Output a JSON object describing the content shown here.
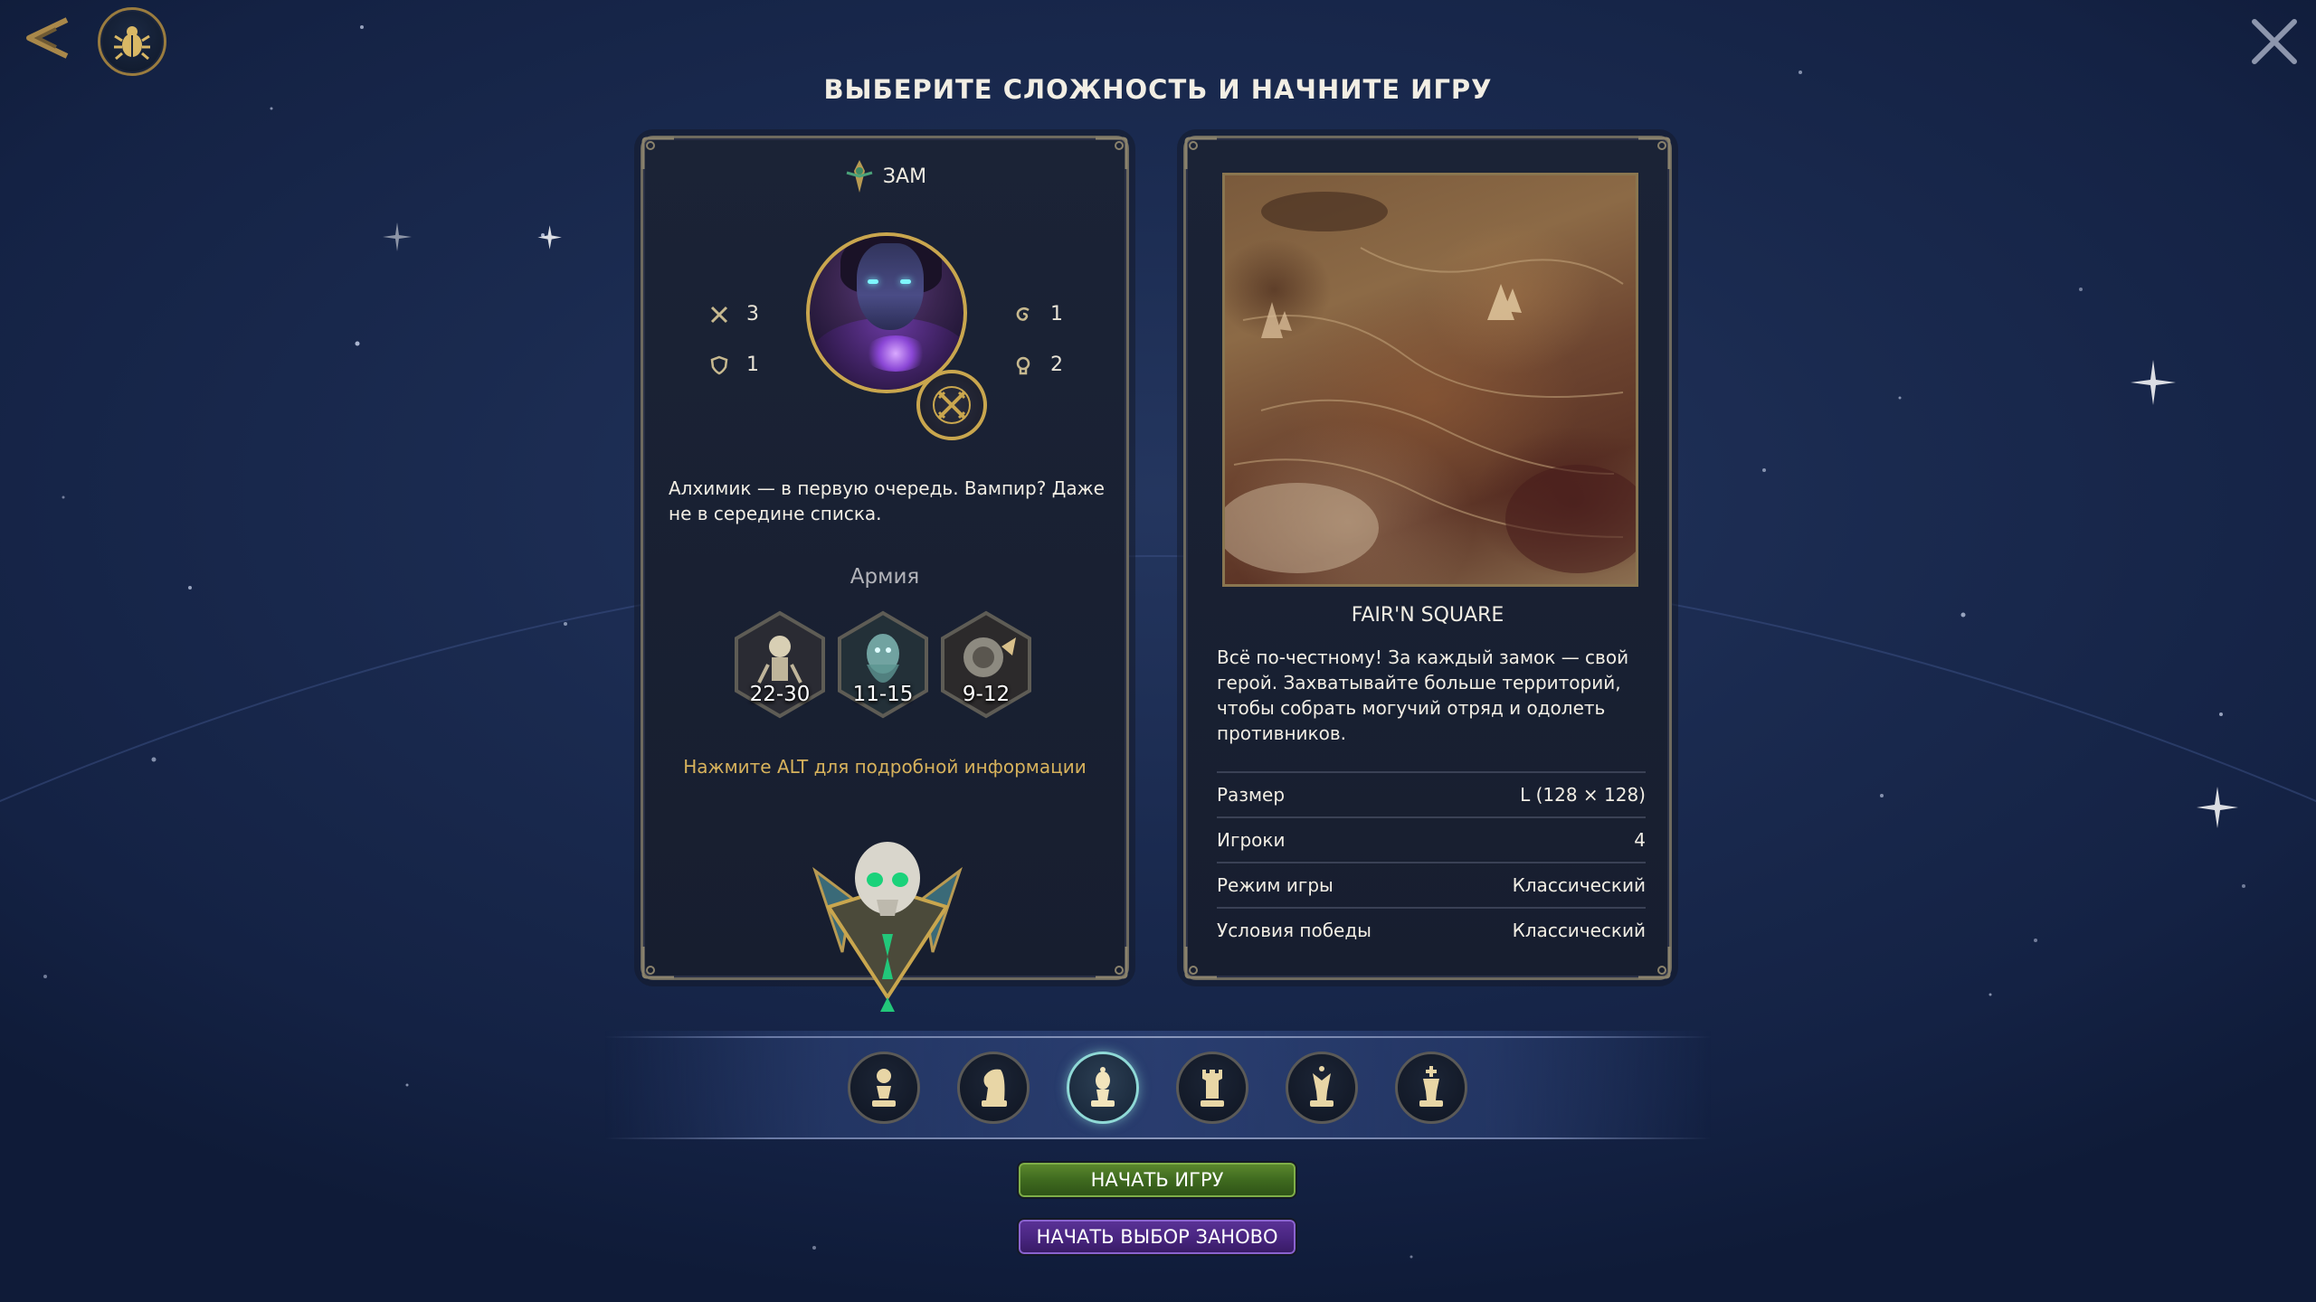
{
  "page": {
    "title": "ВЫБЕРИТЕ СЛОЖНОСТЬ И НАЧНИТЕ ИГРУ"
  },
  "toolbar": {
    "back_icon": "back-arrow-icon",
    "bug_icon": "bug-icon",
    "close_icon": "close-icon"
  },
  "hero": {
    "name": "ЗАМ",
    "stats": [
      {
        "icon": "crossed-swords-icon",
        "value": "3"
      },
      {
        "icon": "shield-icon",
        "value": "1"
      },
      {
        "icon": "spell-power-icon",
        "value": "1"
      },
      {
        "icon": "knowledge-icon",
        "value": "2"
      }
    ],
    "description": "Алхимик — в первую очередь. Вампир? Даже не в середине списка.",
    "army_title": "Армия",
    "army": [
      {
        "icon": "skeleton-unit-icon",
        "count": "22-30"
      },
      {
        "icon": "ghost-unit-icon",
        "count": "11-15"
      },
      {
        "icon": "beast-unit-icon",
        "count": "9-12"
      }
    ],
    "alt_hint": "Нажмите ALT для подробной информации"
  },
  "map": {
    "name": "FAIR'N SQUARE",
    "description": "Всё по-честному! За каждый замок — свой герой. Захватывайте больше территорий, чтобы собрать могучий отряд и одолеть противников.",
    "properties": [
      {
        "label": "Размер",
        "value": "L (128 × 128)"
      },
      {
        "label": "Игроки",
        "value": "4"
      },
      {
        "label": "Режим игры",
        "value": "Классический"
      },
      {
        "label": "Условия победы",
        "value": "Классический"
      }
    ]
  },
  "difficulties": [
    {
      "icon": "pawn-icon"
    },
    {
      "icon": "knight-icon"
    },
    {
      "icon": "bishop-icon",
      "selected": true
    },
    {
      "icon": "rook-icon"
    },
    {
      "icon": "queen-icon"
    },
    {
      "icon": "king-icon"
    }
  ],
  "buttons": {
    "start": "НАЧАТЬ ИГРУ",
    "restart": "НАЧАТЬ ВЫБОР ЗАНОВО"
  },
  "colors": {
    "accent_gold": "#c9a64e",
    "start_green": "#3f6a1f",
    "restart_purple": "#4a2682",
    "selected_teal": "#8fd9d6"
  }
}
